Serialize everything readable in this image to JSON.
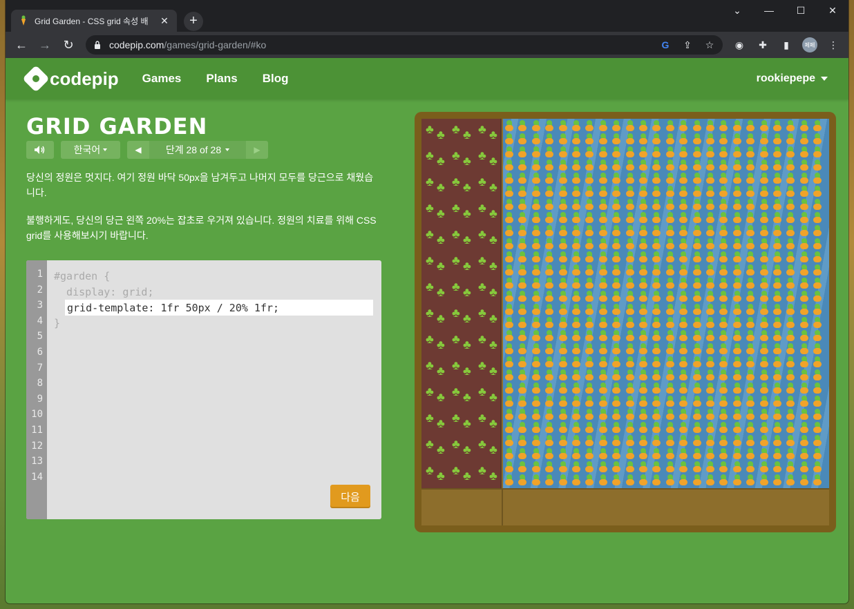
{
  "browser": {
    "tab_title": "Grid Garden - CSS grid 속성 배",
    "url_host": "codepip.com",
    "url_path": "/games/grid-garden/#ko",
    "profile_initials": "페페"
  },
  "site": {
    "logo_text": "codepip",
    "nav": [
      "Games",
      "Plans",
      "Blog"
    ],
    "username": "rookiepepe"
  },
  "game": {
    "title": "GRID GARDEN",
    "language": "한국어",
    "level_label": "단계 28 of 28",
    "description": [
      "당신의 정원은 멋지다. 여기 정원 바닥 50px을 남겨두고 나머지 모두를 당근으로 채웠습니다.",
      "불행하게도, 당신의 당근 왼쪽 20%는 잡초로 우거져 있습니다. 정원의 치료를 위해 CSS grid를 사용해보시기 바랍니다."
    ],
    "next_button": "다음"
  },
  "editor": {
    "line_numbers": [
      "1",
      "2",
      "3",
      "4",
      "5",
      "6",
      "7",
      "8",
      "9",
      "10",
      "11",
      "12",
      "13",
      "14"
    ],
    "line1": "#garden {",
    "line2": "  display: grid;",
    "input_value": "grid-template: 1fr 50px / 20% 1fr;",
    "line4": "}"
  },
  "colors": {
    "page_bg": "#5aa343",
    "header_bg": "#4c9236",
    "button_orange": "#e19a1e",
    "weeds": "#6d3a33",
    "water": "#4a89b9",
    "soil": "#8d6e2c"
  }
}
